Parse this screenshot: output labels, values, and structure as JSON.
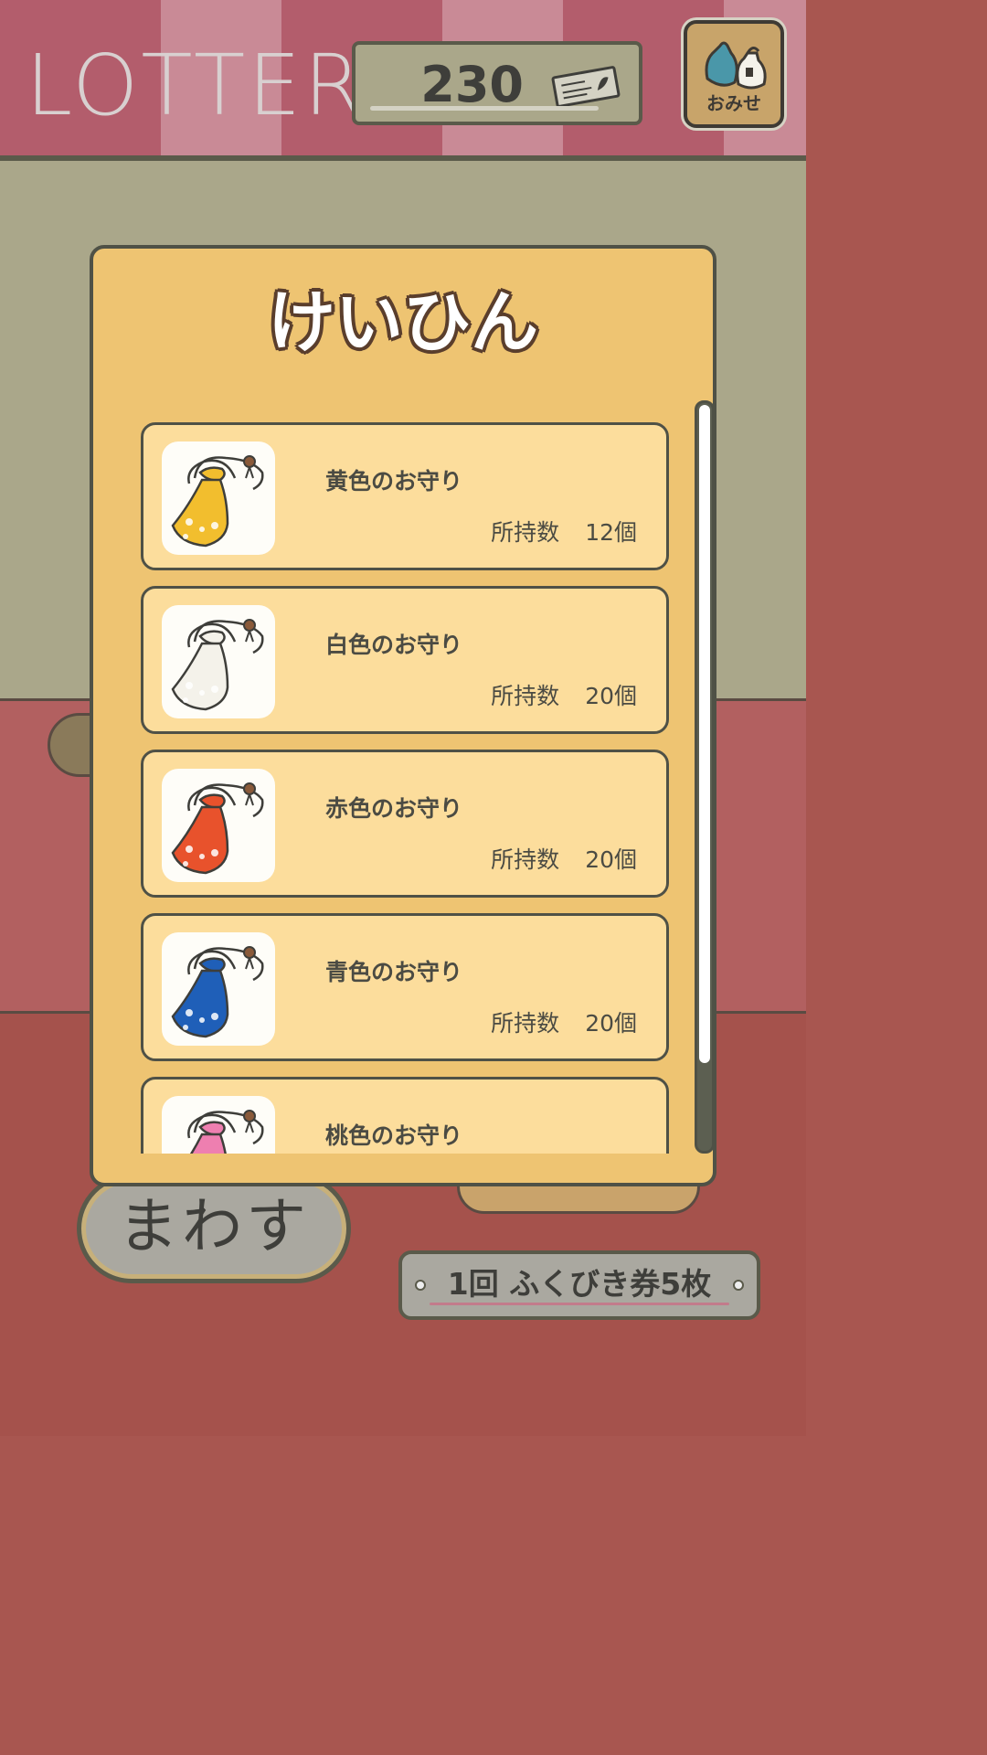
{
  "header": {
    "title": "LOTTERY",
    "ticket_count": "230",
    "shop_label": "おみせ"
  },
  "prizes": {
    "title": "けいひん",
    "items": [
      {
        "name": "黄色のお守り",
        "count_label": "所持数",
        "count": "12個",
        "color": "#f2be2e"
      },
      {
        "name": "白色のお守り",
        "count_label": "所持数",
        "count": "20個",
        "color": "#f4f2ea"
      },
      {
        "name": "赤色のお守り",
        "count_label": "所持数",
        "count": "20個",
        "color": "#e8522c"
      },
      {
        "name": "青色のお守り",
        "count_label": "所持数",
        "count": "20個",
        "color": "#1f5fb8"
      },
      {
        "name": "桃色のお守り",
        "color": "#ee7fb0"
      }
    ]
  },
  "footer": {
    "spin_label": "まわす",
    "cost_label": "1回 ふくびき券5枚"
  }
}
